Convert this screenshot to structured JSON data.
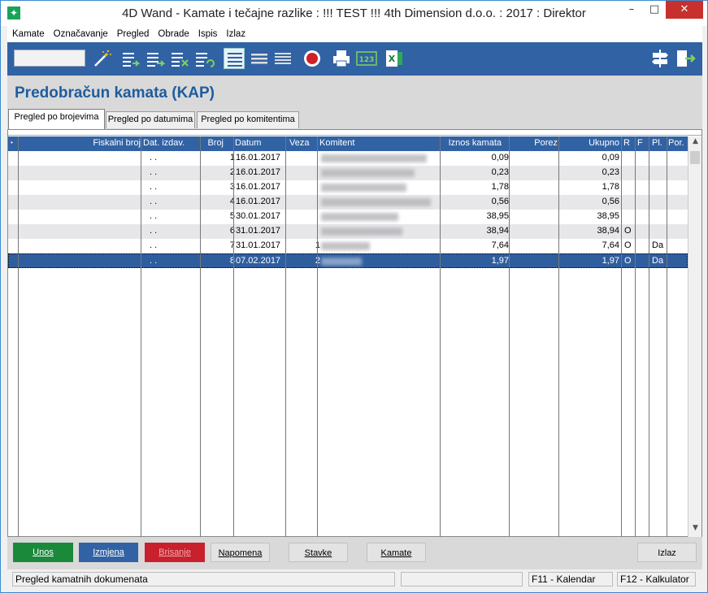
{
  "window": {
    "title": "4D Wand - Kamate i tečajne razlike : !!! TEST !!! 4th Dimension d.o.o. : 2017 : Direktor",
    "minimize": "–",
    "maximize": "□",
    "close": "✕"
  },
  "menu": [
    "Kamate",
    "Označavanje",
    "Pregled",
    "Obrade",
    "Ispis",
    "Izlaz"
  ],
  "toolbar": {
    "search_value": "",
    "icons": [
      "magic-wand",
      "list-add",
      "list-insert",
      "list-delete",
      "list-refresh",
      "view-list-selected",
      "view-list",
      "view-list-dense",
      "record",
      "print",
      "number-123",
      "excel",
      "signpost",
      "exit"
    ]
  },
  "page": {
    "title": "Predobračun kamata (KAP)"
  },
  "tabs": [
    "Pregled po brojevima",
    "Pregled po datumima",
    "Pregled po komitentima"
  ],
  "grid": {
    "columns": {
      "fiskalni": "Fiskalni broj",
      "dat_izdav": "Dat. izdav.",
      "broj": "Broj",
      "datum": "Datum",
      "veza": "Veza",
      "komitent": "Komitent",
      "iznos": "Iznos kamata",
      "porez": "Porez",
      "ukupno": "Ukupno",
      "r": "R",
      "f": "F",
      "pl": "Pl.",
      "por": "Por."
    },
    "rows": [
      {
        "dat_izdav": ". .",
        "broj": "1",
        "datum": "16.01.2017",
        "veza": "",
        "iznos": "0,09",
        "porez": "",
        "ukupno": "0,09",
        "r": "",
        "f": "",
        "pl": "",
        "por": ""
      },
      {
        "dat_izdav": ". .",
        "broj": "2",
        "datum": "16.01.2017",
        "veza": "",
        "iznos": "0,23",
        "porez": "",
        "ukupno": "0,23",
        "r": "",
        "f": "",
        "pl": "",
        "por": ""
      },
      {
        "dat_izdav": ". .",
        "broj": "3",
        "datum": "16.01.2017",
        "veza": "",
        "iznos": "1,78",
        "porez": "",
        "ukupno": "1,78",
        "r": "",
        "f": "",
        "pl": "",
        "por": ""
      },
      {
        "dat_izdav": ". .",
        "broj": "4",
        "datum": "16.01.2017",
        "veza": "",
        "iznos": "0,56",
        "porez": "",
        "ukupno": "0,56",
        "r": "",
        "f": "",
        "pl": "",
        "por": ""
      },
      {
        "dat_izdav": ". .",
        "broj": "5",
        "datum": "30.01.2017",
        "veza": "",
        "iznos": "38,95",
        "porez": "",
        "ukupno": "38,95",
        "r": "",
        "f": "",
        "pl": "",
        "por": ""
      },
      {
        "dat_izdav": ". .",
        "broj": "6",
        "datum": "31.01.2017",
        "veza": "",
        "iznos": "38,94",
        "porez": "",
        "ukupno": "38,94",
        "r": "O",
        "f": "",
        "pl": "",
        "por": ""
      },
      {
        "dat_izdav": ". .",
        "broj": "7",
        "datum": "31.01.2017",
        "veza": "1",
        "iznos": "7,64",
        "porez": "",
        "ukupno": "7,64",
        "r": "O",
        "f": "",
        "pl": "Da",
        "por": ""
      },
      {
        "dat_izdav": ". .",
        "broj": "8",
        "datum": "07.02.2017",
        "veza": "2",
        "iznos": "1,97",
        "porez": "",
        "ukupno": "1,97",
        "r": "O",
        "f": "",
        "pl": "Da",
        "por": ""
      }
    ]
  },
  "buttons": {
    "unos": "Unos",
    "izmjena": "Izmjena",
    "brisanje": "Brisanje",
    "napomena": "Napomena",
    "stavke": "Stavke",
    "kamate": "Kamate",
    "izlaz": "Izlaz"
  },
  "status": {
    "message": "Pregled kamatnih dokumenata",
    "f11": "F11 - Kalendar",
    "f12": "F12 - Kalkulator"
  }
}
